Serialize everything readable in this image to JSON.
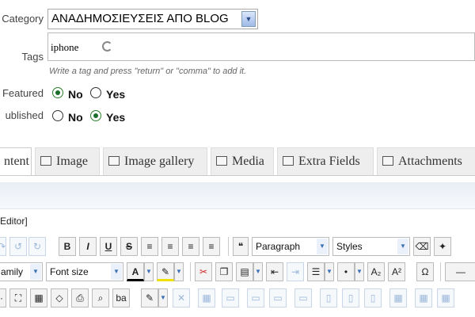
{
  "form": {
    "category_label": "Category",
    "category_value": "ΑΝΑΔΗΜΟΣΙΕΥΣΕΙΣ ΑΠΟ BLOG",
    "tags_label": "Tags",
    "tag_value": "iphone",
    "tags_hint": "Write a tag and press \"return\" or \"comma\" to add it.",
    "featured_label": "Featured",
    "published_label": "ublished",
    "no_label": "No",
    "yes_label": "Yes",
    "featured_selected": "No",
    "published_selected": "Yes"
  },
  "tabs": [
    {
      "label": "ntent"
    },
    {
      "label": "Image"
    },
    {
      "label": "Image gallery"
    },
    {
      "label": "Media"
    },
    {
      "label": "Extra Fields"
    },
    {
      "label": "Attachments"
    }
  ],
  "editor": {
    "label": "Editor]",
    "paragraph_select": "Paragraph",
    "styles_select": "Styles",
    "font_family_select": "amily",
    "font_size_select": "Font size",
    "bold": "B",
    "italic": "I",
    "underline": "U",
    "strike": "S"
  },
  "colors": {
    "accent": "#1a6e2a",
    "select_arrow": "#2b4c8a"
  }
}
